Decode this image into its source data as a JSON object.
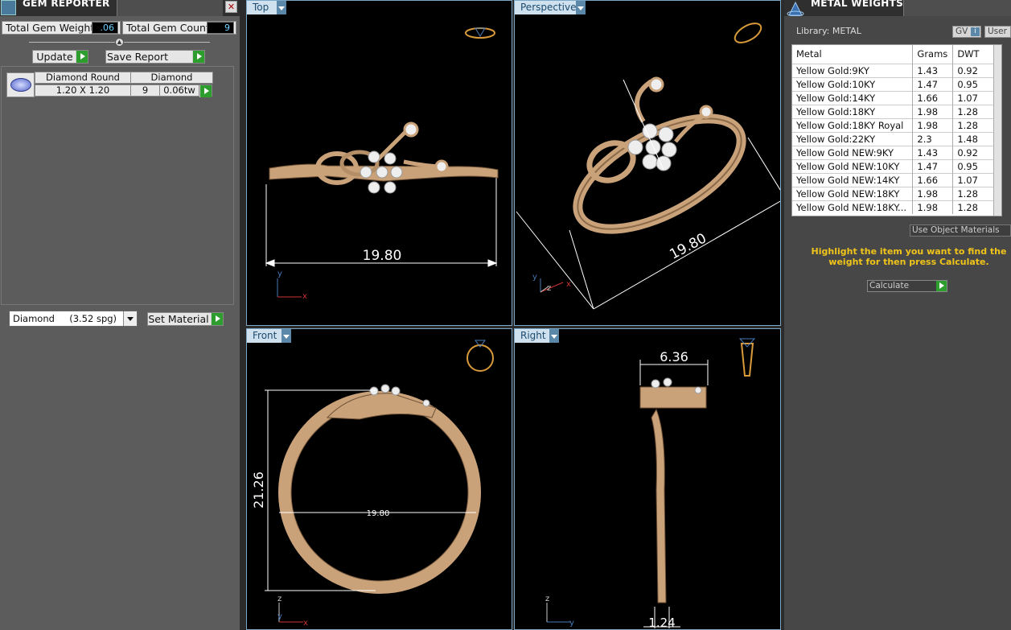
{
  "gem_reporter": {
    "title": "GEM REPORTER",
    "total_weight_label": "Total Gem Weight",
    "total_weight_value": ".06",
    "total_count_label": "Total Gem Count",
    "total_count_value": "9",
    "update_label": "Update",
    "save_label": "Save Report",
    "gem_row": {
      "shape": "Diamond Round",
      "material": "Diamond",
      "size": "1.20 X 1.20",
      "count": "9",
      "weight": "0.06tw"
    },
    "material_select": "Diamond     (3.52 spg)",
    "set_material_label": "Set Material"
  },
  "viewports": {
    "top": {
      "label": "Top",
      "dimension": "19.80"
    },
    "perspective": {
      "label": "Perspective",
      "dimension": "19.80"
    },
    "front": {
      "label": "Front",
      "dim_vertical": "21.26",
      "dim_inner": "19.80"
    },
    "right": {
      "label": "Right",
      "dim_top": "6.36",
      "dim_bottom": "1.24"
    },
    "axes": {
      "x": "x",
      "y": "y",
      "z": "z"
    }
  },
  "metal_weights": {
    "title": "METAL WEIGHTS",
    "library": "Library: METAL",
    "gv_label": "GV",
    "user_label": "User",
    "columns": [
      "Metal",
      "Grams",
      "DWT"
    ],
    "rows": [
      [
        "Yellow Gold:9KY",
        "1.43",
        "0.92"
      ],
      [
        "Yellow Gold:10KY",
        "1.47",
        "0.95"
      ],
      [
        "Yellow Gold:14KY",
        "1.66",
        "1.07"
      ],
      [
        "Yellow Gold:18KY",
        "1.98",
        "1.28"
      ],
      [
        "Yellow Gold:18KY Royal",
        "1.98",
        "1.28"
      ],
      [
        "Yellow Gold:22KY",
        "2.3",
        "1.48"
      ],
      [
        "Yellow Gold NEW:9KY",
        "1.43",
        "0.92"
      ],
      [
        "Yellow Gold NEW:10KY",
        "1.47",
        "0.95"
      ],
      [
        "Yellow Gold NEW:14KY",
        "1.66",
        "1.07"
      ],
      [
        "Yellow Gold NEW:18KY",
        "1.98",
        "1.28"
      ],
      [
        "Yellow Gold NEW:18KY...",
        "1.98",
        "1.28"
      ]
    ],
    "use_object_label": "Use Object Materials",
    "hint": "Highlight the item you want to find the weight for then press Calculate.",
    "calculate_label": "Calculate"
  },
  "colors": {
    "gold": "#c9a27a",
    "viewport_border": "#7aa7c7",
    "accent_green": "#2d9e2d",
    "hint_yellow": "#f0c419"
  }
}
